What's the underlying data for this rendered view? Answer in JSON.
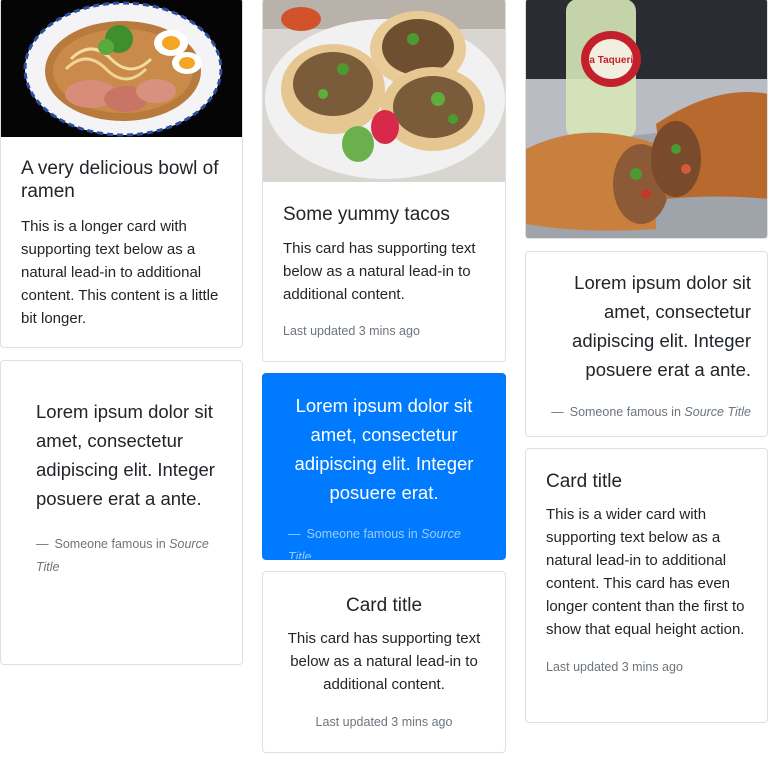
{
  "cards": {
    "ramen": {
      "image_alt": "bowl of ramen",
      "title": "A very delicious bowl of ramen",
      "text": "This is a longer card with supporting text below as a natural lead-in to additional content. This content is a little bit longer."
    },
    "tacos": {
      "image_alt": "plate of tacos",
      "title": "Some yummy tacos",
      "text": "This card has supporting text below as a natural lead-in to additional content.",
      "updated": "Last updated 3 mins ago"
    },
    "burrito": {
      "image_alt": "burrito with a bottle labeled La Taqueria",
      "bottle_label": "La Taqueria"
    },
    "quote_left": {
      "quote": "Lorem ipsum dolor sit amet, consectetur adipiscing elit. Integer posuere erat a ante.",
      "author": "Someone famous in",
      "source": "Source Title"
    },
    "quote_blue": {
      "quote": "Lorem ipsum dolor sit amet, consectetur adipiscing elit. Integer posuere erat.",
      "author": "Someone famous in",
      "source": "Source Title"
    },
    "quote_right": {
      "quote": "Lorem ipsum dolor sit amet, consectetur adipiscing elit. Integer posuere erat a ante.",
      "author": "Someone famous in",
      "source": "Source Title"
    },
    "center_card": {
      "title": "Card title",
      "text": "This card has supporting text below as a natural lead-in to additional content.",
      "updated": "Last updated 3 mins ago"
    },
    "wide_card": {
      "title": "Card title",
      "text": "This is a wider card with supporting text below as a natural lead-in to additional content. This card has even longer content than the first to show that equal height action.",
      "updated": "Last updated 3 mins ago"
    }
  },
  "dash": "—",
  "colors": {
    "primary": "#007bff",
    "muted": "#6c757d",
    "border": "#dfdfdf"
  }
}
